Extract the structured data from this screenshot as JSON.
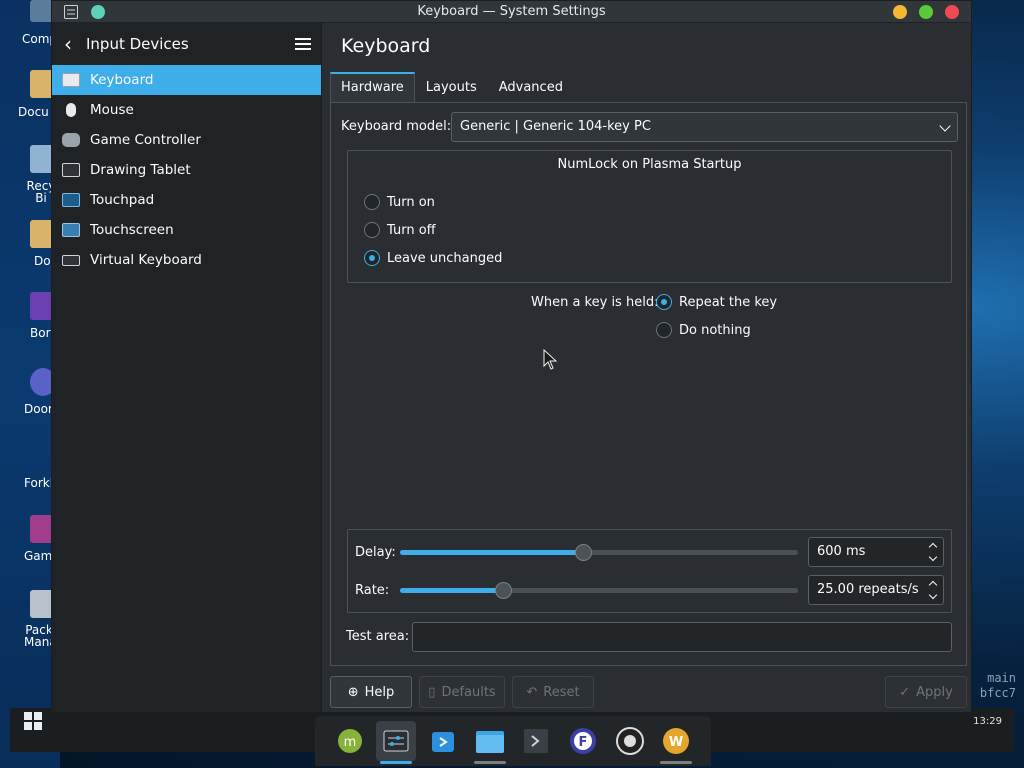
{
  "window": {
    "title": "Keyboard — System Settings"
  },
  "sidebar": {
    "header": "Input Devices",
    "items": [
      {
        "label": "Keyboard",
        "icon": "keyboard-icon"
      },
      {
        "label": "Mouse",
        "icon": "mouse-icon"
      },
      {
        "label": "Game Controller",
        "icon": "gamepad-icon"
      },
      {
        "label": "Drawing Tablet",
        "icon": "tablet-icon"
      },
      {
        "label": "Touchpad",
        "icon": "touchpad-icon"
      },
      {
        "label": "Touchscreen",
        "icon": "touchscreen-icon"
      },
      {
        "label": "Virtual Keyboard",
        "icon": "virtual-keyboard-icon"
      }
    ],
    "active_index": 0
  },
  "content": {
    "title": "Keyboard",
    "tabs": [
      "Hardware",
      "Layouts",
      "Advanced"
    ],
    "active_tab": "Hardware",
    "keyboard_model": {
      "label": "Keyboard model:",
      "value": "Generic | Generic 104-key PC"
    },
    "numlock": {
      "title": "NumLock on Plasma Startup",
      "options": [
        "Turn on",
        "Turn off",
        "Leave unchanged"
      ],
      "selected": "Leave unchanged"
    },
    "key_held": {
      "label": "When a key is held:",
      "options": [
        "Repeat the key",
        "Do nothing"
      ],
      "selected": "Repeat the key"
    },
    "delay": {
      "label": "Delay:",
      "value": "600 ms",
      "slider_fraction": 0.46
    },
    "rate": {
      "label": "Rate:",
      "value": "25.00 repeats/s",
      "slider_fraction": 0.26
    },
    "test_area": {
      "label": "Test area:",
      "value": ""
    }
  },
  "buttons": {
    "help": "Help",
    "defaults": "Defaults",
    "reset": "Reset",
    "apply": "Apply"
  },
  "desktop": {
    "icons": [
      "Comp",
      "Docu",
      "Recy Bi",
      "Do",
      "Bor",
      "Door",
      "Forkl",
      "Gam",
      "Pack Mana"
    ]
  },
  "terminal": {
    "line1": "main",
    "line2": "bfcc7"
  },
  "clock": "13:29",
  "colors": {
    "accent": "#3daee9",
    "window_bg": "#2a2e32",
    "sidebar_bg": "#202326"
  }
}
